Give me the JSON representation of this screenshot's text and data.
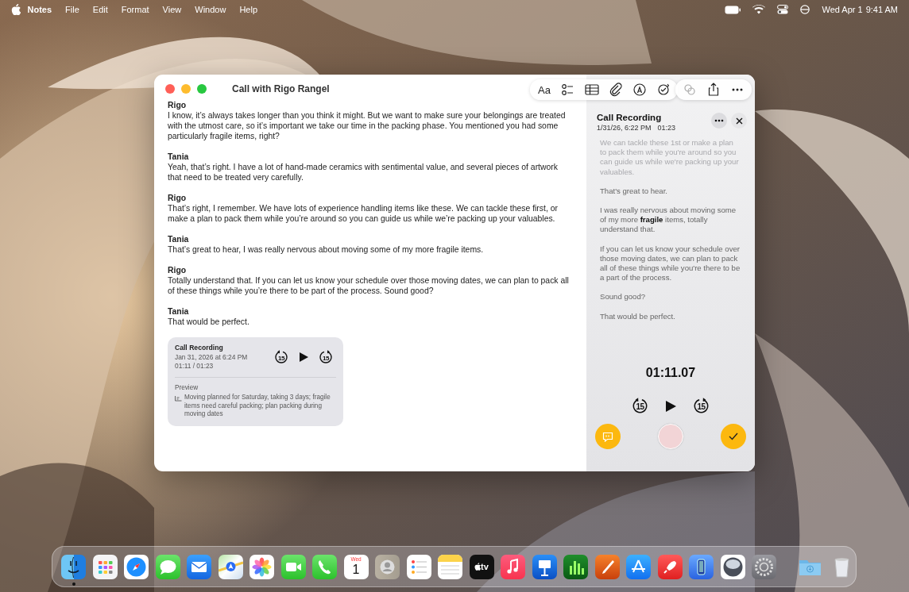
{
  "menu_bar": {
    "app": "Notes",
    "menus": [
      "File",
      "Edit",
      "Format",
      "View",
      "Window",
      "Help"
    ],
    "date": "Wed Apr 1",
    "time": "9:41 AM"
  },
  "window": {
    "title": "Call with Rigo Rangel",
    "format_button": "Aa",
    "transcript": [
      {
        "speaker": "Rigo",
        "text": "I know, it’s always takes longer than you think it might. But we want to make sure your belongings are treated with the utmost care, so it’s important we take our time in the packing phase. You mentioned you had some particularly fragile items, right?"
      },
      {
        "speaker": "Tania",
        "text": "Yeah, that’s right. I have a lot of hand-made ceramics with sentimental value, and several pieces of artwork that need to be treated very carefully."
      },
      {
        "speaker": "Rigo",
        "text": "That’s right, I remember. We have lots of experience handling items like these. We can tackle these first, or make a plan to pack them while you’re around so you can guide us while we’re packing up your valuables."
      },
      {
        "speaker": "Tania",
        "text": "That’s great to hear, I was really nervous about moving some of my more fragile items."
      },
      {
        "speaker": "Rigo",
        "text": "Totally understand that. If you can let us know your schedule over those moving dates, we can plan to pack all of these things while you’re there to be part of the process. Sound good?"
      },
      {
        "speaker": "Tania",
        "text": "That would be perfect."
      }
    ],
    "recording_card": {
      "title": "Call Recording",
      "date": "Jan 31, 2026 at 6:24 PM",
      "progress": "01:11 / 01:23",
      "rewind": "15",
      "forward": "15",
      "preview_label": "Preview",
      "preview": "Moving planned for Saturday, taking 3 days; fragile items need careful packing; plan packing during moving dates"
    }
  },
  "panel": {
    "title": "Call Recording",
    "date": "1/31/26, 6:22 PM",
    "duration": "01:23",
    "transcript": [
      {
        "text": "We can tackle these 1st or make a plan to pack them while you're around so you can guide us while we're packing up your valuables.",
        "faded": true
      },
      {
        "text": "That's great to hear.",
        "faded": false
      },
      {
        "text": "I was really nervous about moving some of my more **fragile** items, totally understand that.",
        "faded": false
      },
      {
        "text": "If you can let us know your schedule over those moving dates, we can plan to pack all of these things while you're there to be a part of the process.",
        "faded": false
      },
      {
        "text": "Sound good?",
        "faded": false
      },
      {
        "text": "That would be perfect.",
        "faded": false
      }
    ],
    "timer": "01:11.07",
    "rewind": "15",
    "forward": "15"
  },
  "dock": {
    "items": [
      {
        "kind": "finder",
        "running": true
      },
      {
        "kind": "launchpad",
        "running": false
      },
      {
        "kind": "safari",
        "running": false
      },
      {
        "kind": "messages",
        "running": false
      },
      {
        "kind": "mail",
        "running": false
      },
      {
        "kind": "maps",
        "running": false
      },
      {
        "kind": "photos",
        "running": false
      },
      {
        "kind": "facetime",
        "running": false
      },
      {
        "kind": "phone",
        "running": false
      },
      {
        "kind": "calendar",
        "running": false,
        "weekday": "Wed",
        "day": "1"
      },
      {
        "kind": "contacts",
        "running": false
      },
      {
        "kind": "reminders",
        "running": false
      },
      {
        "kind": "notes",
        "running": false
      },
      {
        "kind": "tv",
        "running": false,
        "label": "tv"
      },
      {
        "kind": "music",
        "running": false
      },
      {
        "kind": "keynote",
        "running": false
      },
      {
        "kind": "numbers",
        "running": false
      },
      {
        "kind": "pages",
        "running": false
      },
      {
        "kind": "appstore",
        "running": false
      },
      {
        "kind": "rocket",
        "running": false
      },
      {
        "kind": "simulator",
        "running": false
      },
      {
        "kind": "sphere",
        "running": false
      },
      {
        "kind": "settings",
        "running": false
      }
    ],
    "stack": [
      {
        "kind": "downloads"
      },
      {
        "kind": "trash"
      }
    ]
  }
}
